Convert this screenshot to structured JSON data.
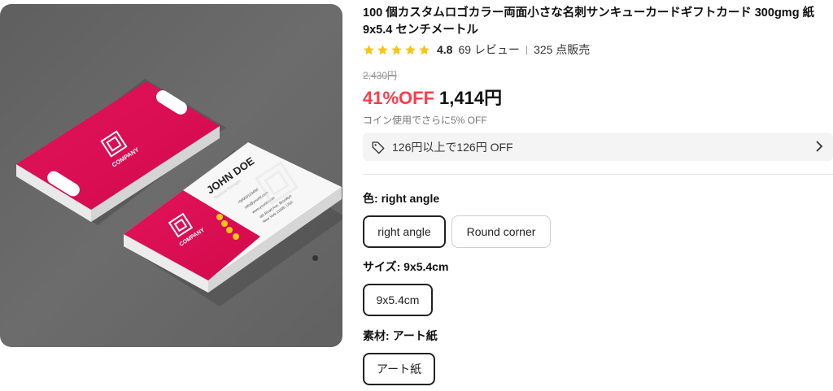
{
  "product": {
    "title": "100 個カスタムロゴカラー両面小さな名刺サンキューカードギフトカード 300gmg 紙 9x5.4 センチメートル",
    "rating": "4.8",
    "reviews": "69 レビュー",
    "sold": "325 点販売",
    "star_count": 5,
    "original_price": "2,430円",
    "discount": "41%OFF",
    "price": "1,414円",
    "coin_note": "コイン使用でさらに5% OFF",
    "coupon": "126円以上で126円 OFF"
  },
  "image": {
    "card_company": "COMPANY",
    "card_tagline": "Your Slogan Here",
    "card_name": "JOHN DOE",
    "card_role": "General Manager",
    "card_phone": "+00000123456",
    "card_email": "info@yourid.com",
    "card_web": "www.yourid.com",
    "card_addr1": "4th Road Ave, Brooklyn",
    "card_addr2": "New York 11005, USA"
  },
  "options": {
    "color": {
      "label": "色:",
      "value": "right angle",
      "choices": [
        "right angle",
        "Round corner"
      ],
      "selected": 0
    },
    "size": {
      "label": "サイズ:",
      "value": "9x5.4cm",
      "choices": [
        "9x5.4cm"
      ],
      "selected": 0
    },
    "material": {
      "label": "素材:",
      "value": "アート紙",
      "choices": [
        "アート紙"
      ],
      "selected": 0
    }
  },
  "colors": {
    "accent_red": "#fb3d4b",
    "star_yellow": "#f5c518",
    "card_pink": "#e20853"
  },
  "icons": [
    "star-icon",
    "tag-icon",
    "chevron-right-icon"
  ]
}
